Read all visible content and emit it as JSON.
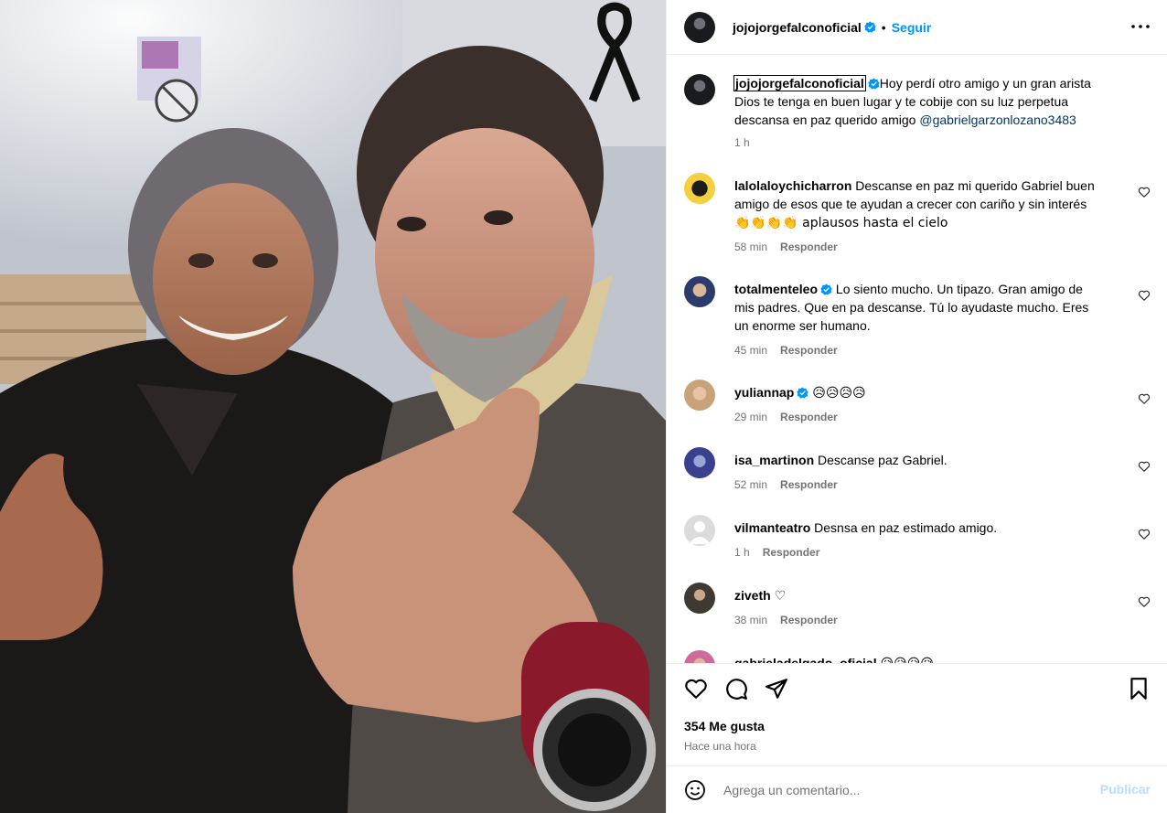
{
  "post": {
    "username": "jojojorgefalconoficial",
    "follow_label": "Seguir",
    "separator": "•",
    "caption_lines": [
      "Hoy perdí otro amigo y un gran arista",
      "Dios te tenga en buen lugar y te cobije con su luz perpetua",
      "descansa en paz querido amigo "
    ],
    "caption_mention": "@gabrielgarzonlozano3483",
    "caption_time": "1 h"
  },
  "comments": [
    {
      "username": "lalolaloychicharron",
      "lines": [
        "Descanse en paz mi querido Gabriel buen",
        "amigo de esos que te ayudan a crecer con cariño y sin interés",
        "👏👏👏👏 aplausos hasta el cielo"
      ],
      "time": "58 min",
      "reply": "Responder"
    },
    {
      "username": "totalmenteleo",
      "verified": true,
      "lines": [
        "Lo siento mucho. Un tipazo. Gran amigo de",
        "mis padres. Que en pa descanse. Tú lo ayudaste mucho. Eres",
        "un enorme ser humano."
      ],
      "time": "45 min",
      "reply": "Responder"
    },
    {
      "username": "yuliannap",
      "verified": true,
      "lines": [
        "😥😥😥😥"
      ],
      "time": "29 min",
      "reply": "Responder"
    },
    {
      "username": "isa_martinon",
      "lines": [
        "Descanse paz Gabriel."
      ],
      "time": "52 min",
      "reply": "Responder"
    },
    {
      "username": "vilmanteatro",
      "lines": [
        "Desnsa en paz estimado amigo."
      ],
      "time": "1 h",
      "reply": "Responder"
    },
    {
      "username": "ziveth",
      "lines": [
        "♡"
      ],
      "time": "38 min",
      "reply": "Responder"
    },
    {
      "username": "gabrieladelgado_oficial",
      "lines": [
        "😥😥😥😥"
      ],
      "time": "",
      "reply": ""
    }
  ],
  "footer": {
    "likes": "354 Me gusta",
    "time_ago": "Hace una hora",
    "comment_placeholder": "Agrega un comentario...",
    "publish_label": "Publicar"
  },
  "colors": {
    "accent": "#0095f6",
    "mention": "#00376b",
    "muted": "#737373",
    "publish_disabled": "#b2dffc"
  },
  "icons": [
    "more-options-icon",
    "verified-badge-icon",
    "like-heart-icon",
    "comment-icon",
    "share-icon",
    "save-bookmark-icon",
    "emoji-icon",
    "mourning-ribbon-icon"
  ]
}
